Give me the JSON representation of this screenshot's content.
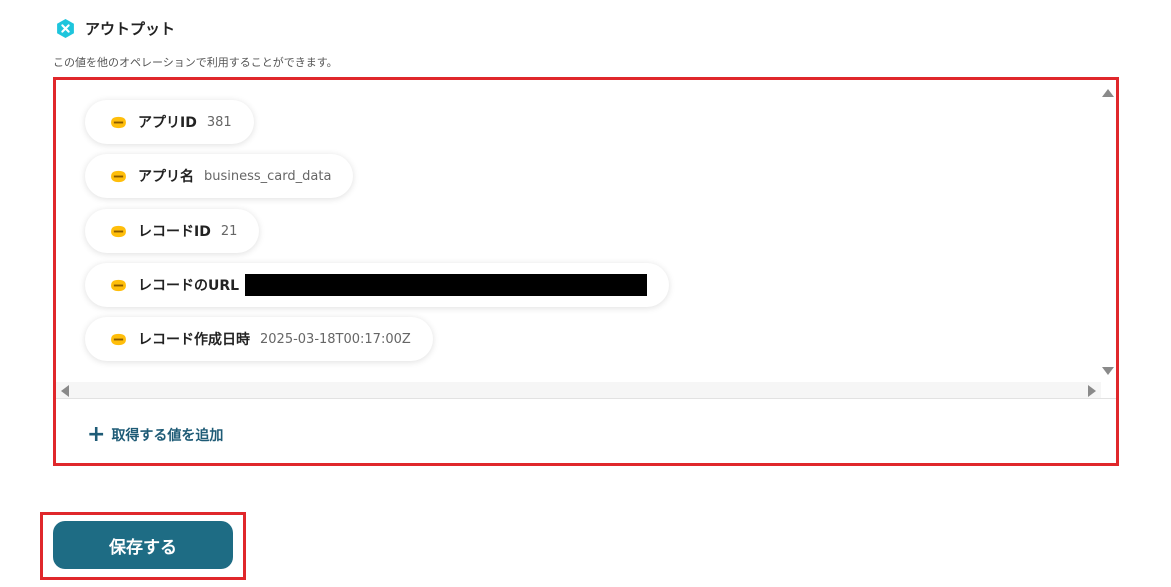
{
  "section": {
    "title": "アウトプット",
    "description": "この値を他のオペレーションで利用することができます。",
    "icon": "yoom-x-icon"
  },
  "outputs": [
    {
      "label": "アプリID",
      "value": "381",
      "icon": "kintone-icon"
    },
    {
      "label": "アプリ名",
      "value": "business_card_data",
      "icon": "kintone-icon"
    },
    {
      "label": "レコードID",
      "value": "21",
      "icon": "kintone-icon"
    },
    {
      "label": "レコードのURL",
      "value": "",
      "redacted": true,
      "icon": "kintone-icon"
    },
    {
      "label": "レコード作成日時",
      "value": "2025-03-18T00:17:00Z",
      "icon": "kintone-icon"
    }
  ],
  "add_value": {
    "label": "取得する値を追加"
  },
  "save_button": {
    "label": "保存する"
  },
  "colors": {
    "accent": "#1e6c84",
    "link": "#1e5b76",
    "highlight_border": "#e0272b",
    "kintone_yellow": "#ffbe0b",
    "icon_cyan": "#1ec5dc"
  }
}
